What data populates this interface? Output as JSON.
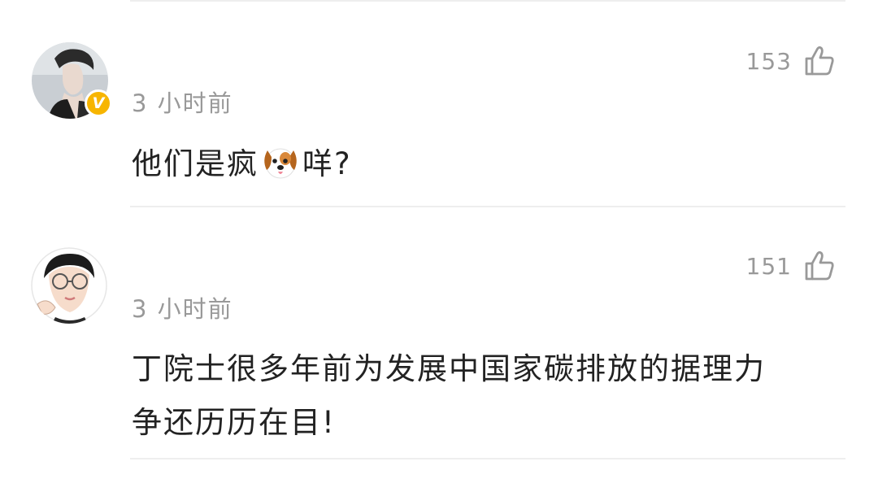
{
  "comments": [
    {
      "like_count": "153",
      "timestamp": "3 小时前",
      "text_before_emoji": "他们是疯",
      "emoji": "dog-face",
      "text_after_emoji": "咩?",
      "verified": true,
      "verified_badge": "V"
    },
    {
      "like_count": "151",
      "timestamp": "3 小时前",
      "text_line1": "丁院士很多年前为发展中国家碳排放的据理力",
      "text_line2": "争还历历在目!",
      "verified": false
    }
  ],
  "colors": {
    "meta_text": "#999999",
    "body_text": "#222222",
    "divider": "#eeeeee",
    "verified_badge": "#f7b500"
  }
}
